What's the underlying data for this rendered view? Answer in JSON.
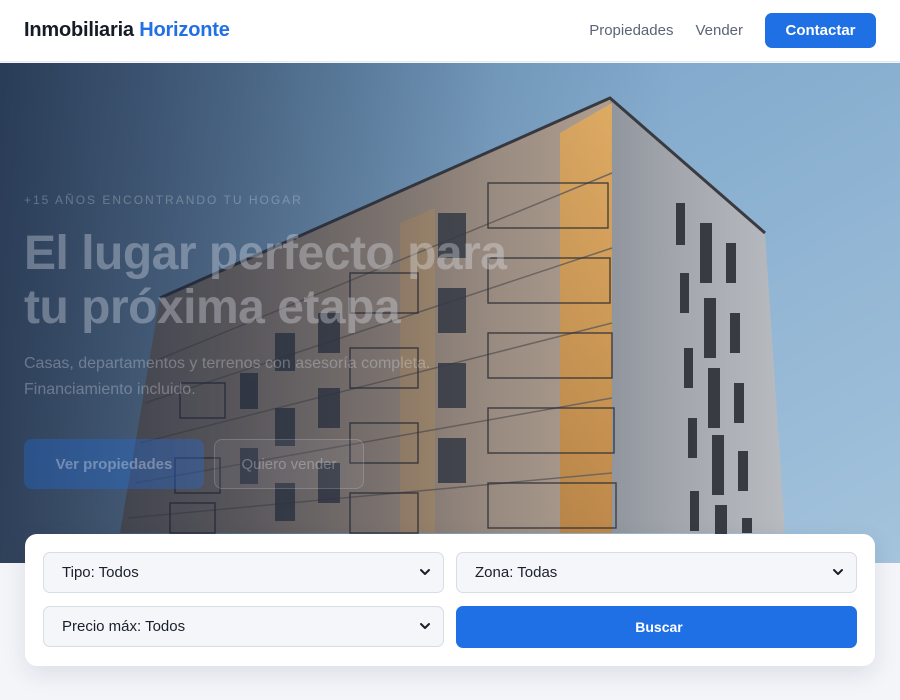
{
  "header": {
    "brand_main": "Inmobiliaria",
    "brand_accent": "Horizonte",
    "nav": [
      {
        "label": "Propiedades"
      },
      {
        "label": "Vender"
      }
    ],
    "cta_label": "Contactar"
  },
  "hero": {
    "eyebrow": "+15 AÑOS ENCONTRANDO TU HOGAR",
    "title_line1": "El lugar perfecto para",
    "title_line2": "tu próxima etapa",
    "subtitle_line1": "Casas, departamentos y terrenos con asesoría completa.",
    "subtitle_line2": "Financiamiento incluido.",
    "primary_button": "Ver propiedades",
    "secondary_button": "Quiero vender",
    "image_icon": "building-photo"
  },
  "search": {
    "tipo": "Tipo: Todos",
    "zona": "Zona: Todas",
    "precio": "Precio máx: Todos",
    "button_glyph": "",
    "button_label": "Buscar"
  },
  "colors": {
    "accent": "#1f6fe5",
    "brand_accent": "#2170e4"
  }
}
